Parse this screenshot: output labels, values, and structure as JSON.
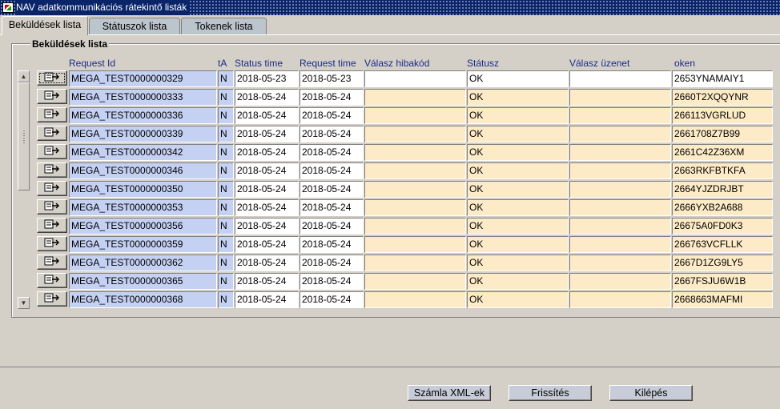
{
  "window": {
    "title": "NAV adatkommunikációs rátekintő listák"
  },
  "tabs": [
    {
      "label": "Beküldések lista",
      "active": true
    },
    {
      "label": "Státuszok lista",
      "active": false
    },
    {
      "label": "Tokenek lista",
      "active": false
    }
  ],
  "group": {
    "title": "Beküldések lista"
  },
  "columns": {
    "request_id": "Request Id",
    "ta": "tA",
    "status_time": "Status time",
    "request_time": "Request time",
    "error_code": "Válasz hibakód",
    "status": "Státusz",
    "message": "Válasz üzenet",
    "token": "oken"
  },
  "rows": [
    {
      "request_id": "MEGA_TEST0000000329",
      "ta": "N",
      "status_time": "2018-05-23",
      "request_time": "2018-05-23",
      "error_code": "",
      "status": "OK",
      "message": "",
      "token": "2653YNAMAIY1"
    },
    {
      "request_id": "MEGA_TEST0000000333",
      "ta": "N",
      "status_time": "2018-05-24",
      "request_time": "2018-05-24",
      "error_code": "",
      "status": "OK",
      "message": "",
      "token": "2660T2XQQYNR"
    },
    {
      "request_id": "MEGA_TEST0000000336",
      "ta": "N",
      "status_time": "2018-05-24",
      "request_time": "2018-05-24",
      "error_code": "",
      "status": "OK",
      "message": "",
      "token": "266113VGRLUD"
    },
    {
      "request_id": "MEGA_TEST0000000339",
      "ta": "N",
      "status_time": "2018-05-24",
      "request_time": "2018-05-24",
      "error_code": "",
      "status": "OK",
      "message": "",
      "token": "2661708Z7B99"
    },
    {
      "request_id": "MEGA_TEST0000000342",
      "ta": "N",
      "status_time": "2018-05-24",
      "request_time": "2018-05-24",
      "error_code": "",
      "status": "OK",
      "message": "",
      "token": "2661C42Z36XM"
    },
    {
      "request_id": "MEGA_TEST0000000346",
      "ta": "N",
      "status_time": "2018-05-24",
      "request_time": "2018-05-24",
      "error_code": "",
      "status": "OK",
      "message": "",
      "token": "2663RKFBTKFA"
    },
    {
      "request_id": "MEGA_TEST0000000350",
      "ta": "N",
      "status_time": "2018-05-24",
      "request_time": "2018-05-24",
      "error_code": "",
      "status": "OK",
      "message": "",
      "token": "2664YJZDRJBT"
    },
    {
      "request_id": "MEGA_TEST0000000353",
      "ta": "N",
      "status_time": "2018-05-24",
      "request_time": "2018-05-24",
      "error_code": "",
      "status": "OK",
      "message": "",
      "token": "2666YXB2A688"
    },
    {
      "request_id": "MEGA_TEST0000000356",
      "ta": "N",
      "status_time": "2018-05-24",
      "request_time": "2018-05-24",
      "error_code": "",
      "status": "OK",
      "message": "",
      "token": "26675A0FD0K3"
    },
    {
      "request_id": "MEGA_TEST0000000359",
      "ta": "N",
      "status_time": "2018-05-24",
      "request_time": "2018-05-24",
      "error_code": "",
      "status": "OK",
      "message": "",
      "token": "266763VCFLLK"
    },
    {
      "request_id": "MEGA_TEST0000000362",
      "ta": "N",
      "status_time": "2018-05-24",
      "request_time": "2018-05-24",
      "error_code": "",
      "status": "OK",
      "message": "",
      "token": "2667D1ZG9LY5"
    },
    {
      "request_id": "MEGA_TEST0000000365",
      "ta": "N",
      "status_time": "2018-05-24",
      "request_time": "2018-05-24",
      "error_code": "",
      "status": "OK",
      "message": "",
      "token": "2667FSJU6W1B"
    },
    {
      "request_id": "MEGA_TEST0000000368",
      "ta": "N",
      "status_time": "2018-05-24",
      "request_time": "2018-05-24",
      "error_code": "",
      "status": "OK",
      "message": "",
      "token": "2668663MAFMI"
    }
  ],
  "buttons": {
    "xml": "Számla XML-ek",
    "refresh": "Frissítés",
    "exit": "Kilépés"
  },
  "colors": {
    "title_bar": "#0a246a",
    "id_cell": "#c5d1f3",
    "response_cell": "#fdebc7",
    "header_text": "#1a2a8a"
  },
  "icons": {
    "row_button": "document-export-icon",
    "window": "app-icon"
  }
}
